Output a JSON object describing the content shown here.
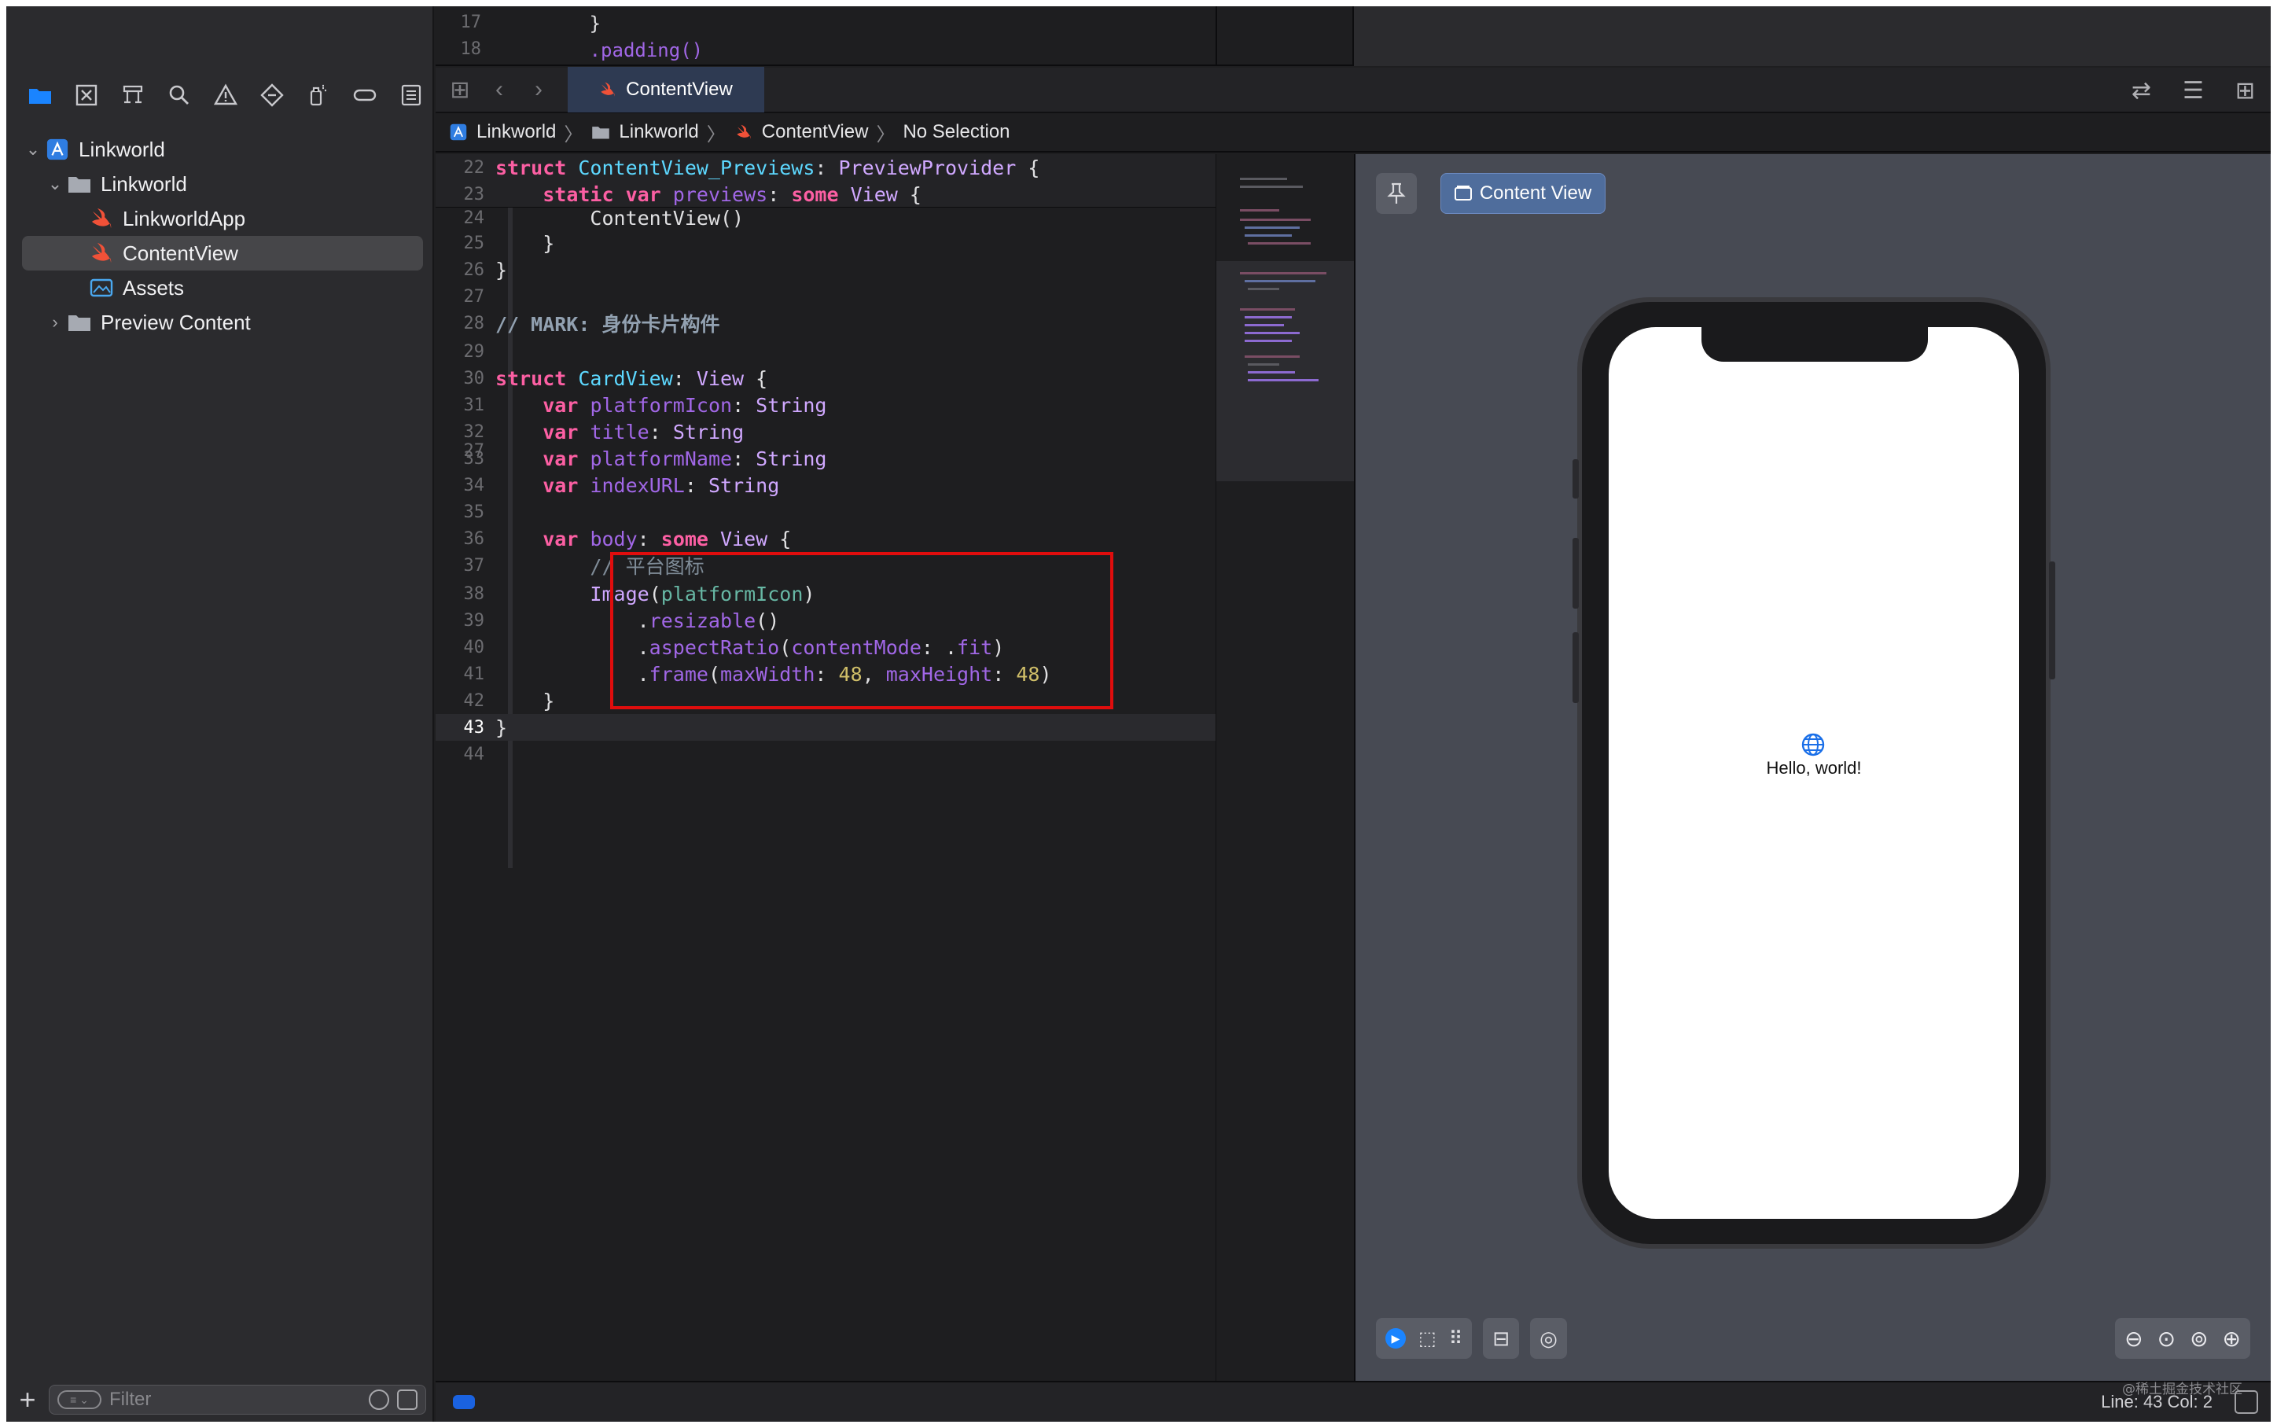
{
  "navigator": {
    "tools": [
      "folder-icon",
      "x-square-icon",
      "hierarchy-icon",
      "search-icon",
      "warning-icon",
      "diamond-icon",
      "spray-icon",
      "tag-icon",
      "list-icon"
    ],
    "tree": [
      {
        "label": "Linkworld",
        "icon": "project-icon",
        "level": 0,
        "expanded": true
      },
      {
        "label": "Linkworld",
        "icon": "folder-icon",
        "level": 1,
        "expanded": true
      },
      {
        "label": "LinkworldApp",
        "icon": "swift-icon",
        "level": 2
      },
      {
        "label": "ContentView",
        "icon": "swift-icon",
        "level": 2,
        "selected": true
      },
      {
        "label": "Assets",
        "icon": "assets-icon",
        "level": 2
      },
      {
        "label": "Preview Content",
        "icon": "folder-icon",
        "level": 2,
        "expanded": false
      }
    ],
    "filter_placeholder": "Filter"
  },
  "top_peek": {
    "lines": [
      {
        "num": "17",
        "text": "        }"
      },
      {
        "num": "18",
        "text": "        .padding()"
      }
    ]
  },
  "tabs": {
    "active": "ContentView"
  },
  "jump_bar": {
    "items": [
      "Linkworld",
      "Linkworld",
      "ContentView",
      "No Selection"
    ]
  },
  "code": {
    "current_line": "43",
    "lines": [
      {
        "num": "22",
        "text": "struct ContentView_Previews: PreviewProvider {"
      },
      {
        "num": "23",
        "text": "    static var previews: some View {"
      },
      {
        "num": "24",
        "text": "        ContentView()"
      },
      {
        "num": "25",
        "text": "    }"
      },
      {
        "num": "26",
        "text": "}"
      },
      {
        "num": "27",
        "text": ""
      },
      {
        "num": "28",
        "text": "// MARK: 身份卡片构件"
      },
      {
        "num": "29",
        "text": ""
      },
      {
        "num": "30",
        "text": "struct CardView: View {"
      },
      {
        "num": "31",
        "text": "    var platformIcon: String"
      },
      {
        "num": "32",
        "text": "    var title: String"
      },
      {
        "num": "33",
        "text": "    var platformName: String"
      },
      {
        "num": "34",
        "text": "    var indexURL: String"
      },
      {
        "num": "35",
        "text": ""
      },
      {
        "num": "36",
        "text": "    var body: some View {"
      },
      {
        "num": "37",
        "text": "        // 平台图标"
      },
      {
        "num": "38",
        "text": "        Image(platformIcon)"
      },
      {
        "num": "39",
        "text": "            .resizable()"
      },
      {
        "num": "40",
        "text": "            .aspectRatio(contentMode: .fit)"
      },
      {
        "num": "41",
        "text": "            .frame(maxWidth: 48, maxHeight: 48)"
      },
      {
        "num": "42",
        "text": "    }"
      },
      {
        "num": "43",
        "text": "}"
      },
      {
        "num": "44",
        "text": ""
      }
    ]
  },
  "preview": {
    "chip_label": "Content View",
    "hello_text": "Hello, world!"
  },
  "status": {
    "position": "Line: 43  Col: 2",
    "watermark": "@稀土掘金技术社区"
  },
  "colors": {
    "highlight_box": "#e00d0d",
    "accent": "#1a84ff",
    "keyword": "#fc5fa3",
    "type": "#5dd8ff"
  }
}
